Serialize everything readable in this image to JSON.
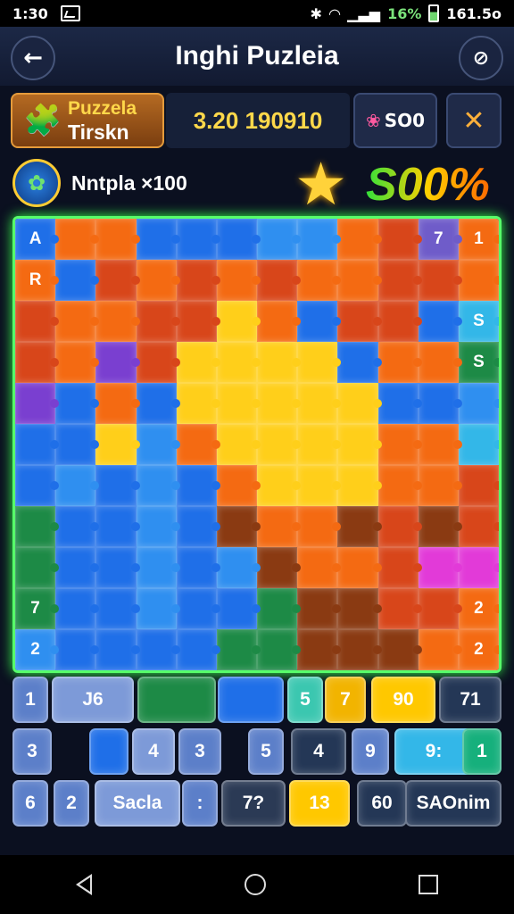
{
  "status_bar": {
    "time": "1:30",
    "battery_percent": "16%",
    "clock_right": "161.5o"
  },
  "header": {
    "title": "Inghi Puzleia",
    "back_icon": "arrow-left-icon",
    "settings_icon": "compass-icon"
  },
  "info": {
    "puzzle_line1": "Puzzela",
    "puzzle_line2": "Tirskn",
    "score": "3.20 190910",
    "coins_label": "SO0",
    "tools_icon": "wrench-hammer-icon"
  },
  "level": {
    "label": "Nntpla ×100",
    "combo": "S00%"
  },
  "board": {
    "rows": 11,
    "cols": 12,
    "colors": {
      "B": "#1f6fe8",
      "L": "#2f8ff0",
      "O": "#f46a12",
      "R": "#d8461a",
      "Y": "#ffcf1a",
      "G": "#ffb000",
      "A": "#f49a10",
      "D": "#8a3a12",
      "N": "#1d8a46",
      "T": "#1eb38c",
      "P": "#7a3fd0",
      "M": "#e23ad8",
      "C": "#33b7e8",
      "K": "#6f5cc9"
    },
    "grid": [
      "BOOBBBLLORKO",
      "OBROROROORRO",
      "ROORRYOBRRBC",
      "ROPRYYYYBOON",
      "PBOBYYYYYBBL",
      "BBYLOYYYYOOC",
      "BLBLBOYYYOOR",
      "NBBLBDOODRDR",
      "NBBLBLDOORMM",
      "NBBLBBNDDRRO",
      "LBBBBNNDDDOO"
    ],
    "labels": [
      {
        "r": 0,
        "c": 0,
        "text": "A"
      },
      {
        "r": 0,
        "c": 10,
        "text": "7"
      },
      {
        "r": 0,
        "c": 11,
        "text": "1"
      },
      {
        "r": 1,
        "c": 0,
        "text": "R"
      },
      {
        "r": 2,
        "c": 11,
        "text": "S"
      },
      {
        "r": 3,
        "c": 11,
        "text": "S"
      },
      {
        "r": 9,
        "c": 0,
        "text": "7"
      },
      {
        "r": 9,
        "c": 11,
        "text": "2"
      },
      {
        "r": 10,
        "c": 0,
        "text": "2"
      },
      {
        "r": 10,
        "c": 11,
        "text": "2"
      }
    ]
  },
  "tray_rows": [
    [
      {
        "label": "1",
        "style": "p-light"
      },
      {
        "label": "J6",
        "style": "p-pale"
      },
      {
        "label": "",
        "style": "p-green"
      },
      {
        "label": "",
        "style": "p-blue"
      },
      {
        "label": "5",
        "style": "p-mint"
      },
      {
        "label": "7",
        "style": "p-gold"
      },
      {
        "label": "90",
        "style": "p-yellow"
      },
      {
        "label": "71",
        "style": "p-navy"
      }
    ],
    [
      {
        "label": "3",
        "style": "p-light"
      },
      {
        "label": "",
        "style": "p-blue"
      },
      {
        "label": "4",
        "style": "p-pale"
      },
      {
        "label": "3",
        "style": "p-light"
      },
      {
        "label": "5",
        "style": "p-light"
      },
      {
        "label": "4",
        "style": "p-navy"
      },
      {
        "label": "9",
        "style": "p-light"
      },
      {
        "label": "9:",
        "style": "p-cyan"
      },
      {
        "label": "1",
        "style": "p-teal"
      }
    ],
    [
      {
        "label": "6",
        "style": "p-light"
      },
      {
        "label": "2",
        "style": "p-light"
      },
      {
        "label": "Sacla",
        "style": "p-pale"
      },
      {
        "label": ":",
        "style": "p-light"
      },
      {
        "label": "7?",
        "style": "p-dark"
      },
      {
        "label": "13",
        "style": "p-yellow"
      },
      {
        "label": "60",
        "style": "p-navy"
      },
      {
        "label": "SAOnim",
        "style": "p-navy"
      }
    ]
  ]
}
